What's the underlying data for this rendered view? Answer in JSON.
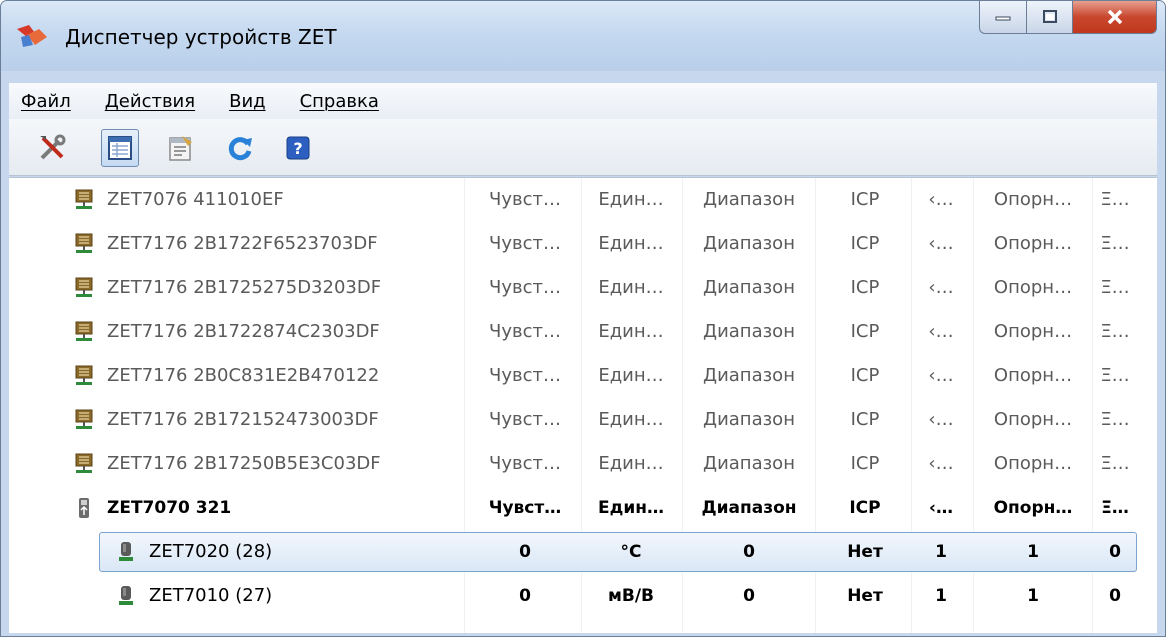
{
  "window": {
    "title": "Диспетчер устройств ZET"
  },
  "menu": [
    {
      "label": "Файл"
    },
    {
      "label": "Действия"
    },
    {
      "label": "Вид"
    },
    {
      "label": "Справка"
    }
  ],
  "toolbar": [
    {
      "icon": "tools-icon"
    },
    {
      "icon": "table-view-icon",
      "active": true
    },
    {
      "icon": "properties-icon"
    },
    {
      "icon": "refresh-icon"
    },
    {
      "icon": "help-icon"
    }
  ],
  "rows": [
    {
      "name": "ZET7076 411010EF",
      "kind": "device",
      "cells": [
        "Чувст…",
        "Един…",
        "Диапазон",
        "ICP",
        "‹…",
        "Опорн…",
        "Ξ…"
      ]
    },
    {
      "name": "ZET7176 2B1722F6523703DF",
      "kind": "device",
      "cells": [
        "Чувст…",
        "Един…",
        "Диапазон",
        "ICP",
        "‹…",
        "Опорн…",
        "Ξ…"
      ]
    },
    {
      "name": "ZET7176 2B1725275D3203DF",
      "kind": "device",
      "cells": [
        "Чувст…",
        "Един…",
        "Диапазон",
        "ICP",
        "‹…",
        "Опорн…",
        "Ξ…"
      ]
    },
    {
      "name": "ZET7176 2B1722874C2303DF",
      "kind": "device",
      "cells": [
        "Чувст…",
        "Един…",
        "Диапазон",
        "ICP",
        "‹…",
        "Опорн…",
        "Ξ…"
      ]
    },
    {
      "name": "ZET7176 2B0C831E2B470122",
      "kind": "device",
      "cells": [
        "Чувст…",
        "Един…",
        "Диапазон",
        "ICP",
        "‹…",
        "Опорн…",
        "Ξ…"
      ]
    },
    {
      "name": "ZET7176 2B172152473003DF",
      "kind": "device",
      "cells": [
        "Чувст…",
        "Един…",
        "Диапазон",
        "ICP",
        "‹…",
        "Опорн…",
        "Ξ…"
      ]
    },
    {
      "name": "ZET7176 2B17250B5E3C03DF",
      "kind": "device",
      "cells": [
        "Чувст…",
        "Един…",
        "Диапазон",
        "ICP",
        "‹…",
        "Опорн…",
        "Ξ…"
      ]
    },
    {
      "name": "ZET7070 321",
      "kind": "usb",
      "cells": [
        "Чувст…",
        "Един…",
        "Диапазон",
        "ICP",
        "‹…",
        "Опорн…",
        "Ξ…"
      ]
    },
    {
      "name": "ZET7020 (28)",
      "kind": "child",
      "selected": true,
      "cells": [
        "0",
        "°C",
        "0",
        "Нет",
        "1",
        "1",
        "0"
      ]
    },
    {
      "name": "ZET7010 (27)",
      "kind": "child",
      "cells": [
        "0",
        "мВ/В",
        "0",
        "Нет",
        "1",
        "1",
        "0"
      ]
    }
  ]
}
